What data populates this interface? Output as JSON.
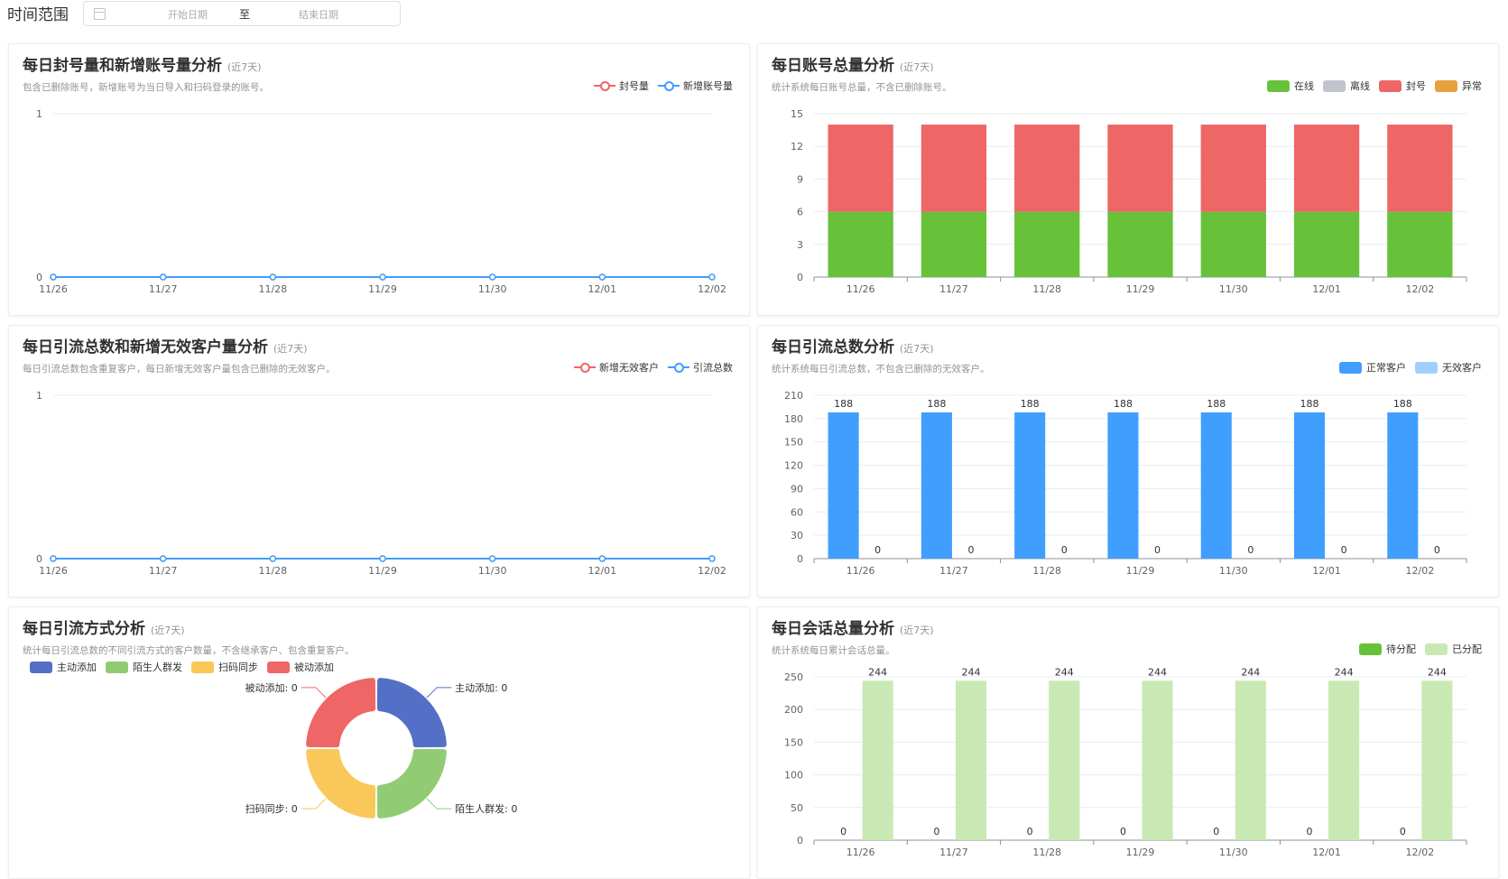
{
  "filter": {
    "label": "时间范围",
    "start_placeholder": "开始日期",
    "separator": "至",
    "end_placeholder": "结束日期"
  },
  "colors": {
    "red": "#ee6666",
    "blue": "#409eff",
    "blue_light": "#a0cfff",
    "green": "#67c23a",
    "green_light": "#c8e9b4",
    "gray": "#c0c4cc",
    "orange": "#e6a23c",
    "pie_blue": "#5470c6",
    "pie_green": "#91cc75",
    "pie_yellow": "#fac858",
    "pie_red": "#ee6666"
  },
  "cards": {
    "c1": {
      "title": "每日封号量和新增账号量分析",
      "subtitle": "(近7天)",
      "desc": "包含已删除账号，新增账号为当日导入和扫码登录的账号。",
      "legend": [
        "封号量",
        "新增账号量"
      ]
    },
    "c2": {
      "title": "每日账号总量分析",
      "subtitle": "(近7天)",
      "desc": "统计系统每日账号总量，不含已删除账号。",
      "legend": [
        "在线",
        "离线",
        "封号",
        "异常"
      ]
    },
    "c3": {
      "title": "每日引流总数和新增无效客户量分析",
      "subtitle": "(近7天)",
      "desc": "每日引流总数包含重复客户，每日新增无效客户量包含已删除的无效客户。",
      "legend": [
        "新增无效客户",
        "引流总数"
      ]
    },
    "c4": {
      "title": "每日引流总数分析",
      "subtitle": "(近7天)",
      "desc": "统计系统每日引流总数，不包含已删除的无效客户。",
      "legend": [
        "正常客户",
        "无效客户"
      ]
    },
    "c5": {
      "title": "每日引流方式分析",
      "subtitle": "(近7天)",
      "desc": "统计每日引流总数的不同引流方式的客户数量，不含继承客户、包含重复客户。",
      "legend": [
        "主动添加",
        "陌生人群发",
        "扫码同步",
        "被动添加"
      ]
    },
    "c6": {
      "title": "每日会话总量分析",
      "subtitle": "(近7天)",
      "desc": "统计系统每日累计会话总量。",
      "legend": [
        "待分配",
        "已分配"
      ]
    }
  },
  "chart_data": [
    {
      "type": "line",
      "categories": [
        "11/26",
        "11/27",
        "11/28",
        "11/29",
        "11/30",
        "12/01",
        "12/02"
      ],
      "series": [
        {
          "name": "封号量",
          "values": [
            0,
            0,
            0,
            0,
            0,
            0,
            0
          ]
        },
        {
          "name": "新增账号量",
          "values": [
            0,
            0,
            0,
            0,
            0,
            0,
            0
          ]
        }
      ],
      "yticks": [
        "0",
        "1"
      ],
      "ylim": [
        0,
        1
      ],
      "grid": true,
      "legend": "top-right"
    },
    {
      "type": "bar",
      "stacked": true,
      "categories": [
        "11/26",
        "11/27",
        "11/28",
        "11/29",
        "11/30",
        "12/01",
        "12/02"
      ],
      "series": [
        {
          "name": "在线",
          "values": [
            6,
            6,
            6,
            6,
            6,
            6,
            6
          ]
        },
        {
          "name": "离线",
          "values": [
            0,
            0,
            0,
            0,
            0,
            0,
            0
          ]
        },
        {
          "name": "封号",
          "values": [
            8,
            8,
            8,
            8,
            8,
            8,
            8
          ]
        },
        {
          "name": "异常",
          "values": [
            0,
            0,
            0,
            0,
            0,
            0,
            0
          ]
        }
      ],
      "yticks": [
        "0",
        "3",
        "6",
        "9",
        "12",
        "15"
      ],
      "ylim": [
        0,
        15
      ],
      "grid": true,
      "legend": "top-right"
    },
    {
      "type": "line",
      "categories": [
        "11/26",
        "11/27",
        "11/28",
        "11/29",
        "11/30",
        "12/01",
        "12/02"
      ],
      "series": [
        {
          "name": "新增无效客户",
          "values": [
            0,
            0,
            0,
            0,
            0,
            0,
            0
          ]
        },
        {
          "name": "引流总数",
          "values": [
            0,
            0,
            0,
            0,
            0,
            0,
            0
          ]
        }
      ],
      "yticks": [
        "0",
        "1"
      ],
      "ylim": [
        0,
        1
      ],
      "grid": true,
      "legend": "top-right"
    },
    {
      "type": "bar",
      "categories": [
        "11/26",
        "11/27",
        "11/28",
        "11/29",
        "11/30",
        "12/01",
        "12/02"
      ],
      "series": [
        {
          "name": "正常客户",
          "values": [
            188,
            188,
            188,
            188,
            188,
            188,
            188
          ],
          "labels": [
            "188",
            "188",
            "188",
            "188",
            "188",
            "188",
            "188"
          ]
        },
        {
          "name": "无效客户",
          "values": [
            0,
            0,
            0,
            0,
            0,
            0,
            0
          ],
          "labels": [
            "0",
            "0",
            "0",
            "0",
            "0",
            "0",
            "0"
          ]
        }
      ],
      "yticks": [
        "0",
        "30",
        "60",
        "90",
        "120",
        "150",
        "180",
        "210"
      ],
      "ylim": [
        0,
        210
      ],
      "grid": true,
      "legend": "top-right"
    },
    {
      "type": "pie",
      "donut": true,
      "series": [
        {
          "name": "主动添加",
          "value": 0,
          "label": "主动添加: 0"
        },
        {
          "name": "陌生人群发",
          "value": 0,
          "label": "陌生人群发: 0"
        },
        {
          "name": "扫码同步",
          "value": 0,
          "label": "扫码同步: 0"
        },
        {
          "name": "被动添加",
          "value": 0,
          "label": "被动添加: 0"
        }
      ],
      "legend": "top-left"
    },
    {
      "type": "bar",
      "categories": [
        "11/26",
        "11/27",
        "11/28",
        "11/29",
        "11/30",
        "12/01",
        "12/02"
      ],
      "series": [
        {
          "name": "待分配",
          "values": [
            0,
            0,
            0,
            0,
            0,
            0,
            0
          ],
          "labels": [
            "0",
            "0",
            "0",
            "0",
            "0",
            "0",
            "0"
          ]
        },
        {
          "name": "已分配",
          "values": [
            244,
            244,
            244,
            244,
            244,
            244,
            244
          ],
          "labels": [
            "244",
            "244",
            "244",
            "244",
            "244",
            "244",
            "244"
          ]
        }
      ],
      "yticks": [
        "0",
        "50",
        "100",
        "150",
        "200",
        "250"
      ],
      "ylim": [
        0,
        250
      ],
      "grid": true,
      "legend": "top-right"
    }
  ]
}
